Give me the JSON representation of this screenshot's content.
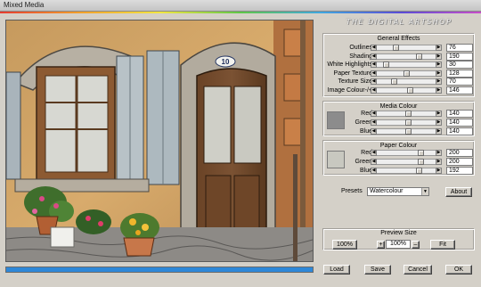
{
  "window": {
    "title": "Mixed Media"
  },
  "brand": "THE DIGITAL ARTSHOP",
  "general_effects": {
    "title": "General Effects",
    "rows": [
      {
        "label": "Outlines",
        "value": "76",
        "level": 0.3
      },
      {
        "label": "Shading",
        "value": "190",
        "level": 0.74
      },
      {
        "label": "White Highlights",
        "value": "30",
        "level": 0.12
      },
      {
        "label": "Paper Texture",
        "value": "128",
        "level": 0.5
      },
      {
        "label": "Texture Size",
        "value": "70",
        "level": 0.27
      },
      {
        "label": "Image Colour-/+",
        "value": "146",
        "level": 0.57
      }
    ]
  },
  "media_colour": {
    "title": "Media Colour",
    "swatch": "#8c8c8c",
    "rows": [
      {
        "label": "Red",
        "value": "140",
        "level": 0.55
      },
      {
        "label": "Green",
        "value": "140",
        "level": 0.55
      },
      {
        "label": "Blue",
        "value": "140",
        "level": 0.55
      }
    ]
  },
  "paper_colour": {
    "title": "Paper Colour",
    "swatch": "#c8c8c0",
    "rows": [
      {
        "label": "Red",
        "value": "200",
        "level": 0.78
      },
      {
        "label": "Green",
        "value": "200",
        "level": 0.78
      },
      {
        "label": "Blue",
        "value": "192",
        "level": 0.75
      }
    ]
  },
  "presets": {
    "label": "Presets",
    "selected": "Watercolour",
    "about": "About"
  },
  "preview_size": {
    "title": "Preview Size",
    "btn_100": "100%",
    "plus": "+",
    "zoom": "100%",
    "minus": "–",
    "fit": "Fit"
  },
  "buttons": {
    "load": "Load",
    "save": "Save",
    "cancel": "Cancel",
    "ok": "OK"
  },
  "progress": {
    "level": 1.0,
    "color": "#2e88d8"
  },
  "house_number": "10"
}
